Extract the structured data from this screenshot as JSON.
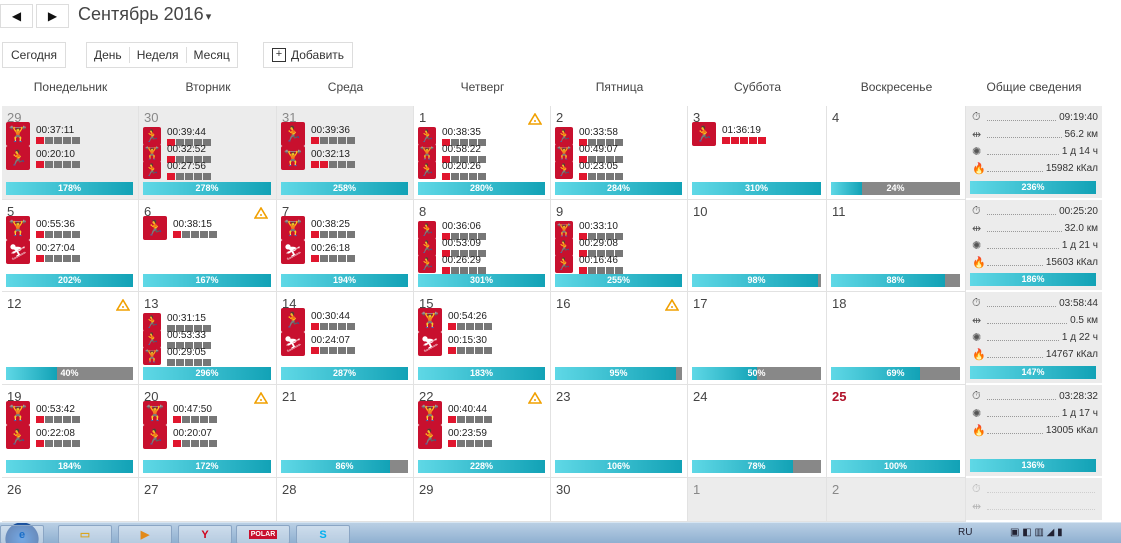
{
  "toolbar": {
    "prev_icon": "◀",
    "next_icon": "▶",
    "month_title": "Сентябрь 2016",
    "dropdown": "▾",
    "today": "Сегодня",
    "view_day": "День",
    "view_week": "Неделя",
    "view_month": "Месяц",
    "add_label": "Добавить"
  },
  "columns": [
    "Понедельник",
    "Вторник",
    "Среда",
    "Четверг",
    "Пятница",
    "Суббота",
    "Воскресенье",
    "Общие сведения"
  ],
  "colors": {
    "activity": "#c8102e",
    "bar_fill": "#12a2b6",
    "bar_track": "#888888",
    "summary_bg": "#ececec"
  },
  "weeks": [
    {
      "days": [
        {
          "num": "29",
          "style": "muted",
          "gray": true,
          "acts": [
            {
              "icon": "strength-icon",
              "time": "00:37:11",
              "load": 1
            },
            {
              "icon": "running-icon",
              "time": "00:20:10",
              "load": 1
            }
          ],
          "bar": {
            "label": "178%",
            "fill": 1
          }
        },
        {
          "num": "30",
          "style": "muted",
          "gray": true,
          "acts": [
            {
              "icon": "running-icon",
              "time": "00:39:44",
              "load": 1,
              "small": true
            },
            {
              "icon": "strength-icon",
              "time": "00:32:52",
              "load": 1,
              "small": true
            },
            {
              "icon": "running-icon",
              "time": "00:27:56",
              "load": 1,
              "small": true
            }
          ],
          "bar": {
            "label": "278%",
            "fill": 1
          }
        },
        {
          "num": "31",
          "style": "muted",
          "gray": true,
          "acts": [
            {
              "icon": "running-icon",
              "time": "00:39:36",
              "load": 1
            },
            {
              "icon": "strength-icon",
              "time": "00:32:13",
              "load": 2
            }
          ],
          "bar": {
            "label": "258%",
            "fill": 1
          }
        },
        {
          "num": "1",
          "warn": true,
          "acts": [
            {
              "icon": "running-icon",
              "time": "00:38:35",
              "load": 1,
              "small": true
            },
            {
              "icon": "strength-icon",
              "time": "00:58:22",
              "load": 1,
              "small": true
            },
            {
              "icon": "running-icon",
              "time": "00:20:26",
              "load": 1,
              "small": true
            }
          ],
          "bar": {
            "label": "280%",
            "fill": 1
          }
        },
        {
          "num": "2",
          "acts": [
            {
              "icon": "running-icon",
              "time": "00:33:58",
              "load": 1,
              "small": true
            },
            {
              "icon": "strength-icon",
              "time": "00:49:07",
              "load": 1,
              "small": true
            },
            {
              "icon": "running-icon",
              "time": "00:23:05",
              "load": 1,
              "small": true
            }
          ],
          "bar": {
            "label": "284%",
            "fill": 1
          }
        },
        {
          "num": "3",
          "acts": [
            {
              "icon": "running-icon",
              "time": "01:36:19",
              "load": 5
            }
          ],
          "bar": {
            "label": "310%",
            "fill": 1
          }
        },
        {
          "num": "4",
          "acts": [],
          "bar": {
            "label": "24%",
            "fill": 0.24
          }
        }
      ],
      "summary": {
        "rows": [
          {
            "icon": "stopwatch-icon",
            "value": "09:19:40"
          },
          {
            "icon": "distance-icon",
            "value": "56.2 км"
          },
          {
            "icon": "recovery-icon",
            "value": "1 д 14 ч"
          },
          {
            "icon": "flame-icon",
            "value": "15982 кКал"
          }
        ],
        "bar": {
          "label": "236%",
          "fill": 1
        }
      }
    },
    {
      "days": [
        {
          "num": "5",
          "acts": [
            {
              "icon": "strength-icon",
              "time": "00:55:36",
              "load": 1
            },
            {
              "icon": "skiing-icon",
              "time": "00:27:04",
              "load": 1
            }
          ],
          "bar": {
            "label": "202%",
            "fill": 1
          }
        },
        {
          "num": "6",
          "warn": true,
          "acts": [
            {
              "icon": "running-icon",
              "time": "00:38:15",
              "load": 1
            }
          ],
          "bar": {
            "label": "167%",
            "fill": 1
          }
        },
        {
          "num": "7",
          "acts": [
            {
              "icon": "strength-icon",
              "time": "00:38:25",
              "load": 1
            },
            {
              "icon": "skiing-icon",
              "time": "00:26:18",
              "load": 1
            }
          ],
          "bar": {
            "label": "194%",
            "fill": 1
          }
        },
        {
          "num": "8",
          "acts": [
            {
              "icon": "running-icon",
              "time": "00:36:06",
              "load": 1,
              "small": true
            },
            {
              "icon": "running-icon",
              "time": "00:53:09",
              "load": 1,
              "small": true
            },
            {
              "icon": "running-icon",
              "time": "00:26:29",
              "load": 1,
              "small": true
            }
          ],
          "bar": {
            "label": "301%",
            "fill": 1
          }
        },
        {
          "num": "9",
          "acts": [
            {
              "icon": "strength-icon",
              "time": "00:33:10",
              "load": 1,
              "small": true
            },
            {
              "icon": "running-icon",
              "time": "00:29:08",
              "load": 1,
              "small": true
            },
            {
              "icon": "running-icon",
              "time": "00:16:46",
              "load": 1,
              "small": true
            }
          ],
          "bar": {
            "label": "255%",
            "fill": 1
          }
        },
        {
          "num": "10",
          "acts": [],
          "bar": {
            "label": "98%",
            "fill": 0.98
          }
        },
        {
          "num": "11",
          "acts": [],
          "bar": {
            "label": "88%",
            "fill": 0.88
          }
        }
      ],
      "summary": {
        "rows": [
          {
            "icon": "stopwatch-icon",
            "value": "00:25:20"
          },
          {
            "icon": "distance-icon",
            "value": "32.0 км"
          },
          {
            "icon": "recovery-icon",
            "value": "1 д 21 ч"
          },
          {
            "icon": "flame-icon",
            "value": "15603 кКал"
          }
        ],
        "bar": {
          "label": "186%",
          "fill": 1
        }
      }
    },
    {
      "days": [
        {
          "num": "12",
          "warn": true,
          "acts": [],
          "bar": {
            "label": "40%",
            "fill": 0.4
          }
        },
        {
          "num": "13",
          "acts": [
            {
              "icon": "running-icon",
              "time": "00:31:15",
              "load": 0,
              "small": true
            },
            {
              "icon": "running-icon",
              "time": "00:53:33",
              "load": 0,
              "small": true
            },
            {
              "icon": "strength-icon",
              "time": "00:29:05",
              "load": 0,
              "small": true
            }
          ],
          "bar": {
            "label": "296%",
            "fill": 1
          }
        },
        {
          "num": "14",
          "acts": [
            {
              "icon": "running-icon",
              "time": "00:30:44",
              "load": 1
            },
            {
              "icon": "skiing-icon",
              "time": "00:24:07",
              "load": 1
            }
          ],
          "bar": {
            "label": "287%",
            "fill": 1
          }
        },
        {
          "num": "15",
          "acts": [
            {
              "icon": "strength-icon",
              "time": "00:54:26",
              "load": 1
            },
            {
              "icon": "skiing-icon",
              "time": "00:15:30",
              "load": 1
            }
          ],
          "bar": {
            "label": "183%",
            "fill": 1
          }
        },
        {
          "num": "16",
          "warn": true,
          "acts": [],
          "bar": {
            "label": "95%",
            "fill": 0.95
          }
        },
        {
          "num": "17",
          "acts": [],
          "bar": {
            "label": "50%",
            "fill": 0.5
          }
        },
        {
          "num": "18",
          "acts": [],
          "bar": {
            "label": "69%",
            "fill": 0.69
          }
        }
      ],
      "summary": {
        "rows": [
          {
            "icon": "stopwatch-icon",
            "value": "03:58:44"
          },
          {
            "icon": "distance-icon",
            "value": "0.5 км"
          },
          {
            "icon": "recovery-icon",
            "value": "1 д 22 ч"
          },
          {
            "icon": "flame-icon",
            "value": "14767 кКал"
          }
        ],
        "bar": {
          "label": "147%",
          "fill": 1
        }
      }
    },
    {
      "days": [
        {
          "num": "19",
          "acts": [
            {
              "icon": "strength-icon",
              "time": "00:53:42",
              "load": 1
            },
            {
              "icon": "running-icon",
              "time": "00:22:08",
              "load": 1
            }
          ],
          "bar": {
            "label": "184%",
            "fill": 1
          }
        },
        {
          "num": "20",
          "warn": true,
          "acts": [
            {
              "icon": "strength-icon",
              "time": "00:47:50",
              "load": 1
            },
            {
              "icon": "running-icon",
              "time": "00:20:07",
              "load": 1
            }
          ],
          "bar": {
            "label": "172%",
            "fill": 1
          }
        },
        {
          "num": "21",
          "acts": [],
          "bar": {
            "label": "86%",
            "fill": 0.86
          }
        },
        {
          "num": "22",
          "warn": true,
          "acts": [
            {
              "icon": "strength-icon",
              "time": "00:40:44",
              "load": 1
            },
            {
              "icon": "running-icon",
              "time": "00:23:59",
              "load": 1
            }
          ],
          "bar": {
            "label": "228%",
            "fill": 1
          }
        },
        {
          "num": "23",
          "acts": [],
          "bar": {
            "label": "106%",
            "fill": 1
          }
        },
        {
          "num": "24",
          "acts": [],
          "bar": {
            "label": "78%",
            "fill": 0.78
          }
        },
        {
          "num": "25",
          "style": "red",
          "acts": [],
          "bar": {
            "label": "100%",
            "fill": 1
          }
        }
      ],
      "summary": {
        "rows": [
          {
            "icon": "stopwatch-icon",
            "value": "03:28:32"
          },
          {
            "icon": "recovery-icon",
            "value": "1 д 17 ч"
          },
          {
            "icon": "flame-icon",
            "value": "13005 кКал"
          }
        ],
        "bar": {
          "label": "136%",
          "fill": 1
        }
      }
    },
    {
      "days": [
        {
          "num": "26",
          "acts": []
        },
        {
          "num": "27",
          "acts": []
        },
        {
          "num": "28",
          "acts": []
        },
        {
          "num": "29",
          "acts": []
        },
        {
          "num": "30",
          "acts": []
        },
        {
          "num": "1",
          "style": "muted",
          "gray": true,
          "acts": []
        },
        {
          "num": "2",
          "style": "muted",
          "gray": true,
          "acts": []
        }
      ],
      "summary": {
        "rows": [
          {
            "icon": "stopwatch-icon",
            "value": ""
          },
          {
            "icon": "distance-icon",
            "value": ""
          }
        ]
      }
    }
  ],
  "taskbar": {
    "apps": [
      "internet-explorer-icon",
      "folder-icon",
      "media-player-icon",
      "yandex-icon",
      "polar-icon",
      "skype-icon"
    ],
    "polar_label": "POLAR",
    "lang": "RU"
  }
}
